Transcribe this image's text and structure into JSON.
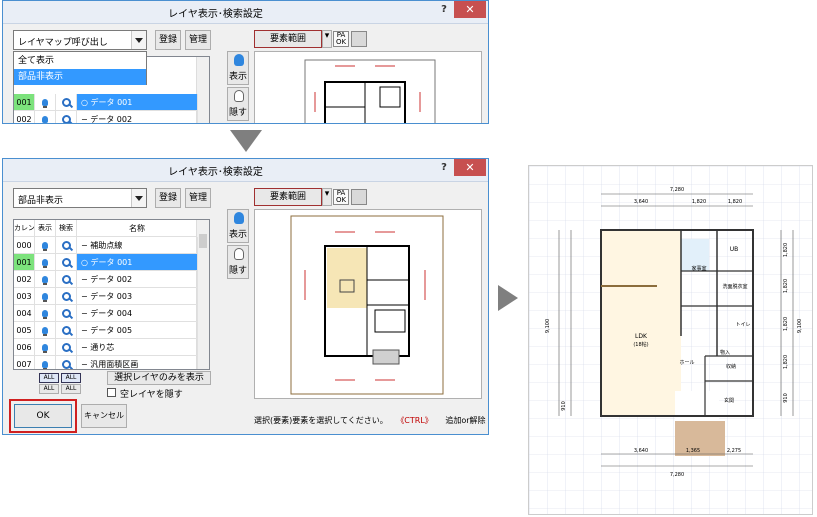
{
  "dialog_title": "レイヤ表示･検索設定",
  "help_button": "?",
  "close_button": "✕",
  "top_dialog": {
    "combo_value": "レイヤマップ呼び出し",
    "register_button": "登録",
    "manage_button": "管理",
    "dropdown_items": [
      "全て表示",
      "部品非表示"
    ],
    "rows": [
      {
        "num": "001",
        "name": "○ データ 001"
      },
      {
        "num": "002",
        "name": "− データ 002"
      }
    ]
  },
  "bottom_dialog": {
    "combo_value": "部品非表示",
    "register_button": "登録",
    "manage_button": "管理",
    "columns": [
      "カレント",
      "表示",
      "検索",
      "名称"
    ],
    "rows": [
      {
        "num": "000",
        "name": "− 補助点線"
      },
      {
        "num": "001",
        "name": "○ データ 001"
      },
      {
        "num": "002",
        "name": "− データ 002"
      },
      {
        "num": "003",
        "name": "− データ 003"
      },
      {
        "num": "004",
        "name": "− データ 004"
      },
      {
        "num": "005",
        "name": "− データ 005"
      },
      {
        "num": "006",
        "name": "− 通り芯"
      },
      {
        "num": "007",
        "name": "− 汎用面積区画"
      }
    ],
    "all_buttons": [
      "ALL",
      "ALL",
      "ALL",
      "ALL"
    ],
    "show_selected_only_button": "選択レイヤのみを表示",
    "hide_empty_checkbox": "空レイヤを隠す",
    "ok_button": "OK",
    "cancel_button": "キャンセル",
    "status_text": "選択(要素)要素を選択してください。",
    "status_ctrl": "《CTRL》",
    "status_add": "追加or解除"
  },
  "side_buttons": {
    "show": "表示",
    "hide": "隠す"
  },
  "toolbar": {
    "element_range": "要素範囲",
    "pa_ok": "PA\nOK"
  },
  "plan": {
    "top_dim_total": "7,280",
    "top_dims": [
      "3,640",
      "1,820",
      "1,820"
    ],
    "bottom_dims": [
      "3,640",
      "1,365",
      "2,275"
    ],
    "bottom_dim_total": "7,280",
    "rooms": [
      "UB",
      "家事室",
      "洗面脱衣室",
      "トイレ",
      "LDK",
      "(18帖)",
      "ホール",
      "物入",
      "収納",
      "玄関"
    ],
    "side_dim_left": "9,100",
    "side_dim_right": "9,100",
    "side_dims_right": [
      "1,820",
      "1,820",
      "1,820",
      "1,820",
      "910"
    ],
    "small_left": "910"
  },
  "colors": {
    "selection": "#3399ff",
    "current_green": "#7ce27c",
    "ok_highlight": "#d02020",
    "close_red": "#c75050"
  }
}
